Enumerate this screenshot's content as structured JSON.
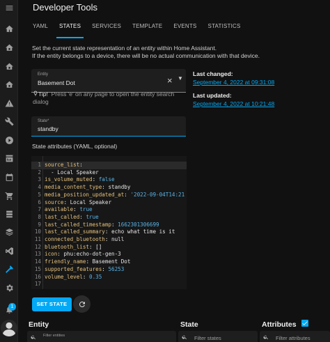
{
  "header": {
    "title": "Developer Tools",
    "tabs": [
      {
        "label": "YAML",
        "active": false
      },
      {
        "label": "STATES",
        "active": true
      },
      {
        "label": "SERVICES",
        "active": false
      },
      {
        "label": "TEMPLATE",
        "active": false
      },
      {
        "label": "EVENTS",
        "active": false
      },
      {
        "label": "STATISTICS",
        "active": false
      }
    ]
  },
  "sidebar": {
    "icons": [
      "menu-icon",
      "overview-icon",
      "home-icon",
      "home-icon",
      "home-icon",
      "alert-icon",
      "wrench-icon",
      "media-icon",
      "history-icon",
      "calendar-icon",
      "cart-icon",
      "storage-icon",
      "layers-icon",
      "vscode-icon",
      "hammer-icon",
      "gear-icon",
      "bell-icon"
    ],
    "notification_count": "1"
  },
  "description": {
    "line1": "Set the current state representation of an entity within Home Assistant.",
    "line2": "If the entity belongs to a device, there will be no actual communication with that device."
  },
  "entity_field": {
    "label": "Entity",
    "value": "Basement Dot"
  },
  "tip": {
    "label": "Tip!",
    "text": "Press 'e' on any page to open the entity search dialog"
  },
  "state_field": {
    "label": "State*",
    "value": "standby"
  },
  "attributes_label": "State attributes (YAML, optional)",
  "yaml_lines": [
    [
      {
        "t": "source_list",
        "c": "k"
      },
      {
        "t": ":",
        "c": "p"
      }
    ],
    [
      {
        "t": "  - Local Speaker",
        "c": "p"
      }
    ],
    [
      {
        "t": "is_volume_muted",
        "c": "k"
      },
      {
        "t": ": ",
        "c": "p"
      },
      {
        "t": "false",
        "c": "b"
      }
    ],
    [
      {
        "t": "media_content_type",
        "c": "k"
      },
      {
        "t": ": standby",
        "c": "p"
      }
    ],
    [
      {
        "t": "media_position_updated_at",
        "c": "k"
      },
      {
        "t": ": ",
        "c": "p"
      },
      {
        "t": "'2022-09-04T14:21",
        "c": "s"
      }
    ],
    [
      {
        "t": "source",
        "c": "k"
      },
      {
        "t": ": Local Speaker",
        "c": "p"
      }
    ],
    [
      {
        "t": "available",
        "c": "k"
      },
      {
        "t": ": ",
        "c": "p"
      },
      {
        "t": "true",
        "c": "b"
      }
    ],
    [
      {
        "t": "last_called",
        "c": "k"
      },
      {
        "t": ": ",
        "c": "p"
      },
      {
        "t": "true",
        "c": "b"
      }
    ],
    [
      {
        "t": "last_called_timestamp",
        "c": "k"
      },
      {
        "t": ": ",
        "c": "p"
      },
      {
        "t": "1662301306699",
        "c": "n"
      }
    ],
    [
      {
        "t": "last_called_summary",
        "c": "k"
      },
      {
        "t": ": echo what time is it",
        "c": "p"
      }
    ],
    [
      {
        "t": "connected_bluetooth",
        "c": "k"
      },
      {
        "t": ": null",
        "c": "p"
      }
    ],
    [
      {
        "t": "bluetooth_list",
        "c": "k"
      },
      {
        "t": ": []",
        "c": "p"
      }
    ],
    [
      {
        "t": "icon",
        "c": "k"
      },
      {
        "t": ": phu:echo-dot-gen-3",
        "c": "p"
      }
    ],
    [
      {
        "t": "friendly_name",
        "c": "k"
      },
      {
        "t": ": Basement Dot",
        "c": "p"
      }
    ],
    [
      {
        "t": "supported_features",
        "c": "k"
      },
      {
        "t": ": ",
        "c": "p"
      },
      {
        "t": "56253",
        "c": "n"
      }
    ],
    [
      {
        "t": "volume_level",
        "c": "k"
      },
      {
        "t": ": ",
        "c": "p"
      },
      {
        "t": "0.35",
        "c": "n"
      }
    ],
    []
  ],
  "buttons": {
    "set_state": "SET STATE"
  },
  "info": {
    "last_changed_label": "Last changed:",
    "last_changed_value": "September 4, 2022 at 09:31:08",
    "last_updated_label": "Last updated:",
    "last_updated_value": "September 4, 2022 at 10:21:48"
  },
  "table": {
    "col_entity": "Entity",
    "col_state": "State",
    "col_attributes": "Attributes",
    "attributes_checked": true,
    "filter_entities": "Filter entities",
    "filter_states": "Filter states",
    "filter_attributes": "Filter attributes"
  },
  "colors": {
    "accent": "#03a9f4",
    "background": "#111111",
    "yaml_key": "#e5c07b",
    "yaml_value": "#58b4e8"
  }
}
